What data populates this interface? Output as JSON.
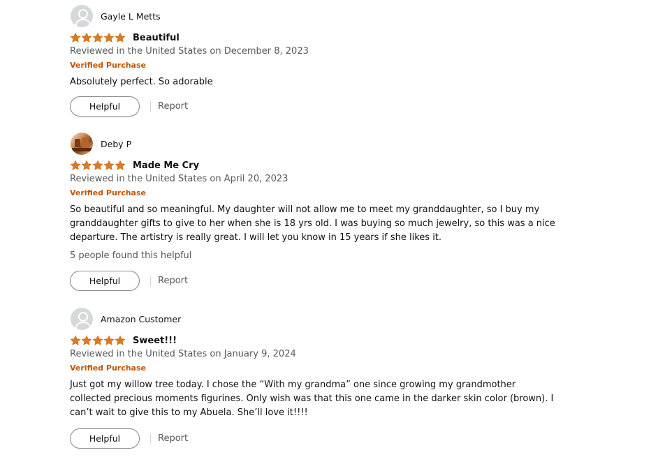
{
  "colors": {
    "star": "#de7921",
    "verified": "#c45500",
    "muted": "#565959"
  },
  "reviews": [
    {
      "profile_name": "Gayle L Metts",
      "avatar": "default-avatar-icon",
      "rating": 5,
      "title": "Beautiful",
      "date": "Reviewed in the United States on December 8, 2023",
      "verified": "Verified Purchase",
      "body_lines": [
        "Absolutely perfect. So adorable"
      ],
      "helpful_count": "",
      "helpful_label": "Helpful",
      "report_label": "Report"
    },
    {
      "profile_name": "Deby P",
      "avatar": "profile-photo",
      "rating": 5,
      "title": "Made Me Cry",
      "date": "Reviewed in the United States on April 20, 2023",
      "verified": "Verified Purchase",
      "body_lines": [
        "So beautiful and so meaningful. My daughter will not allow me to meet my granddaughter, so I buy my",
        "granddaughter gifts to give to her when she is 18 yrs old. I was buying so much jewelry, so this was a nice",
        "departure. The artistry is really great. I will let you know in 15 years if she likes it."
      ],
      "helpful_count": "5 people found this helpful",
      "helpful_label": "Helpful",
      "report_label": "Report"
    },
    {
      "profile_name": "Amazon Customer",
      "avatar": "default-avatar-icon",
      "rating": 5,
      "title": "Sweet!!!",
      "date": "Reviewed in the United States on January 9, 2024",
      "verified": "Verified Purchase",
      "body_lines": [
        "Just got my willow tree today. I chose the “With my grandma” one since growing my grandmother",
        "collected precious moments figurines. Only wish was that this one came in the darker skin color (brown). I",
        "can’t wait to give this to my Abuela. She’ll love it!!!!"
      ],
      "helpful_count": "",
      "helpful_label": "Helpful",
      "report_label": "Report"
    }
  ]
}
